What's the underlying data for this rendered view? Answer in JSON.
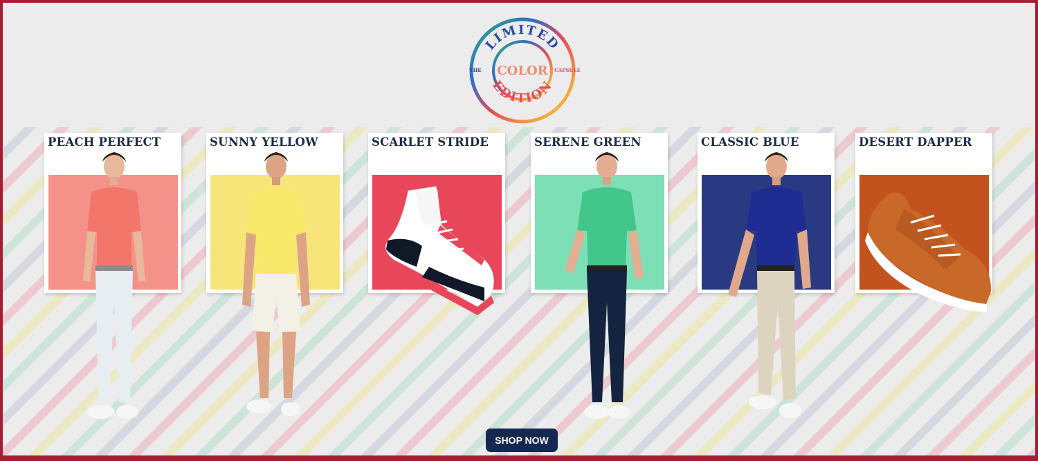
{
  "badge": {
    "top_text": "LIMITED",
    "center_text": "COLOR",
    "left_text": "THE",
    "right_text": "CAPSULE",
    "bottom_text": "EDITION"
  },
  "cards": [
    {
      "title": "PEACH PERFECT",
      "color": "#f4928a"
    },
    {
      "title": "SUNNY YELLOW",
      "color": "#f8e57a"
    },
    {
      "title": "SCARLET STRIDE",
      "color": "#e84659"
    },
    {
      "title": "SERENE GREEN",
      "color": "#7ddfb6"
    },
    {
      "title": "CLASSIC BLUE",
      "color": "#2a3a82"
    },
    {
      "title": "DESERT DAPPER",
      "color": "#c2531f"
    }
  ],
  "cta": {
    "label": "SHOP NOW",
    "color": "#142850"
  },
  "icons": [
    "limited-edition-badge-icon",
    "polo-shirt-icon",
    "sneaker-icon"
  ]
}
